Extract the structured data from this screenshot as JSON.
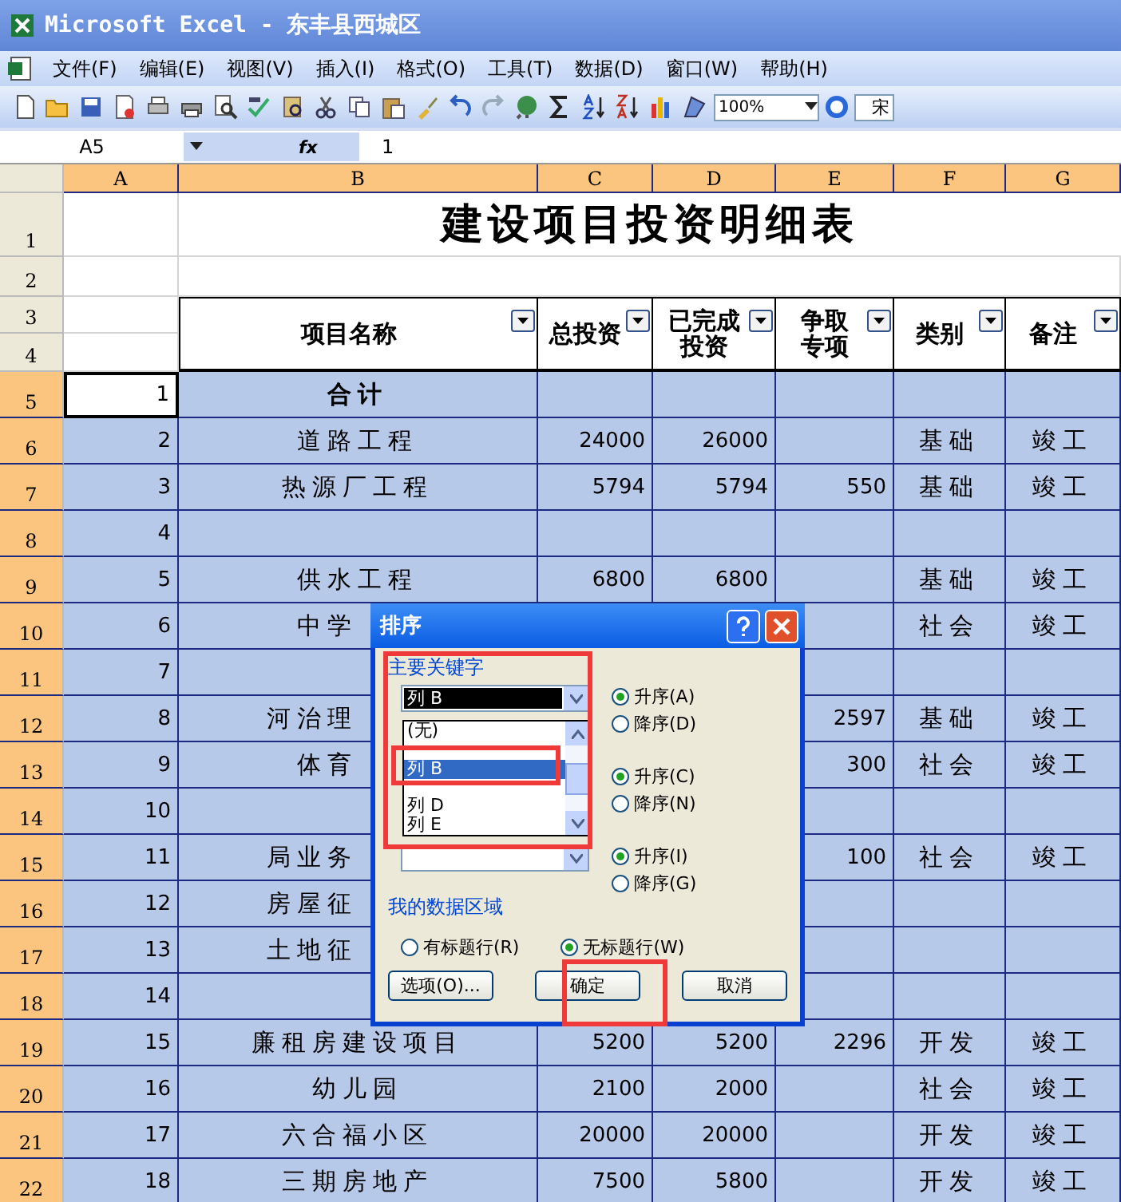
{
  "window": {
    "title": "Microsoft Excel - 东丰县西城区"
  },
  "menu": [
    {
      "label": "文件(F)"
    },
    {
      "label": "编辑(E)"
    },
    {
      "label": "视图(V)"
    },
    {
      "label": "插入(I)"
    },
    {
      "label": "格式(O)"
    },
    {
      "label": "工具(T)"
    },
    {
      "label": "数据(D)"
    },
    {
      "label": "窗口(W)"
    },
    {
      "label": "帮助(H)"
    }
  ],
  "toolbar": {
    "zoom": "100%",
    "font": "宋"
  },
  "formula_bar": {
    "cell": "A5",
    "fx": "fx",
    "value": "1"
  },
  "sheet": {
    "columns": [
      {
        "label": "A"
      },
      {
        "label": "B"
      },
      {
        "label": "C"
      },
      {
        "label": "D"
      },
      {
        "label": "E"
      },
      {
        "label": "F"
      },
      {
        "label": "G"
      }
    ],
    "top_rows": [
      {
        "header": "1"
      },
      {
        "header": "2"
      },
      {
        "header": "3"
      },
      {
        "header": "4"
      }
    ],
    "title": "建设项目投资明细表",
    "headers": [
      {
        "lines": [
          "项目名称"
        ]
      },
      {
        "lines": [
          "总投资"
        ]
      },
      {
        "lines": [
          "已完成",
          "投资"
        ]
      },
      {
        "lines": [
          "争取",
          "专项"
        ]
      },
      {
        "lines": [
          "类别"
        ]
      },
      {
        "lines": [
          "备注"
        ]
      }
    ],
    "rows": [
      {
        "header": "5",
        "selected": true,
        "active": true,
        "total": true,
        "cells": {
          "a": "1",
          "b": "合计"
        }
      },
      {
        "header": "6",
        "selected": true,
        "active": false,
        "total": false,
        "cells": {
          "a": "2",
          "b": "道路工程",
          "c": "24000",
          "d": "26000",
          "f": "基础",
          "g": "竣工"
        }
      },
      {
        "header": "7",
        "selected": true,
        "active": false,
        "total": false,
        "cells": {
          "a": "3",
          "b": "热源厂工程",
          "c": "5794",
          "d": "5794",
          "e": "550",
          "f": "基础",
          "g": "竣工"
        }
      },
      {
        "header": "8",
        "selected": true,
        "active": false,
        "total": false,
        "cells": {
          "a": "4"
        }
      },
      {
        "header": "9",
        "selected": true,
        "active": false,
        "total": false,
        "cells": {
          "a": "5",
          "b": "供水工程",
          "c": "6800",
          "d": "6800",
          "f": "基础",
          "g": "竣工"
        }
      },
      {
        "header": "10",
        "selected": true,
        "active": false,
        "total": false,
        "cells": {
          "a": "6",
          "b": "中学",
          "f": "社会",
          "g": "竣工"
        }
      },
      {
        "header": "11",
        "selected": true,
        "active": false,
        "total": false,
        "cells": {
          "a": "7"
        }
      },
      {
        "header": "12",
        "selected": true,
        "active": false,
        "total": false,
        "cells": {
          "a": "8",
          "b": "河治理",
          "e": "2597",
          "f": "基础",
          "g": "竣工"
        }
      },
      {
        "header": "13",
        "selected": true,
        "active": false,
        "total": false,
        "cells": {
          "a": "9",
          "b": "体育",
          "e": "300",
          "f": "社会",
          "g": "竣工"
        }
      },
      {
        "header": "14",
        "selected": true,
        "active": false,
        "total": false,
        "cells": {
          "a": "10"
        }
      },
      {
        "header": "15",
        "selected": true,
        "active": false,
        "total": false,
        "cells": {
          "a": "11",
          "b": "局业务",
          "e": "100",
          "f": "社会",
          "g": "竣工"
        }
      },
      {
        "header": "16",
        "selected": true,
        "active": false,
        "total": false,
        "cells": {
          "a": "12",
          "b": "房屋征"
        }
      },
      {
        "header": "17",
        "selected": true,
        "active": false,
        "total": false,
        "cells": {
          "a": "13",
          "b": "土地征"
        }
      },
      {
        "header": "18",
        "selected": true,
        "active": false,
        "total": false,
        "cells": {
          "a": "14"
        }
      },
      {
        "header": "19",
        "selected": true,
        "active": false,
        "total": false,
        "cells": {
          "a": "15",
          "b": "廉租房建设项目",
          "c": "5200",
          "d": "5200",
          "e": "2296",
          "f": "开发",
          "g": "竣工"
        }
      },
      {
        "header": "20",
        "selected": true,
        "active": false,
        "total": false,
        "cells": {
          "a": "16",
          "b": "幼儿园",
          "c": "2100",
          "d": "2000",
          "f": "社会",
          "g": "竣工"
        }
      },
      {
        "header": "21",
        "selected": true,
        "active": false,
        "total": false,
        "cells": {
          "a": "17",
          "b": "六合福小区",
          "c": "20000",
          "d": "20000",
          "f": "开发",
          "g": "竣工"
        }
      },
      {
        "header": "22",
        "selected": true,
        "active": false,
        "total": false,
        "cells": {
          "a": "18",
          "b": "三期房地产",
          "c": "7500",
          "d": "5800",
          "f": "开发",
          "g": "竣工"
        }
      }
    ]
  },
  "dialog": {
    "title": "排序",
    "keys": [
      {
        "label": "主要关键字",
        "value": "列 B",
        "order": [
          {
            "label": "升序(A)",
            "selected": true
          },
          {
            "label": "降序(D)",
            "selected": false
          }
        ]
      },
      {
        "order": [
          {
            "label": "升序(C)",
            "selected": true
          },
          {
            "label": "降序(N)",
            "selected": false
          }
        ]
      },
      {
        "order": [
          {
            "label": "升序(I)",
            "selected": true
          },
          {
            "label": "降序(G)",
            "selected": false
          }
        ]
      }
    ],
    "dropdown": [
      {
        "label": "(无)",
        "selected": false
      },
      {
        "selected": false
      },
      {
        "label": "列 B",
        "selected": true
      },
      {
        "selected": false
      },
      {
        "label": "列 D",
        "selected": false
      },
      {
        "label": "列 E",
        "selected": false
      }
    ],
    "range_label": "我的数据区域",
    "range_options": [
      {
        "label": "有标题行(R)",
        "selected": false
      },
      {
        "label": "无标题行(W)",
        "selected": true
      }
    ],
    "buttons": [
      {
        "label": "选项(O)..."
      },
      {
        "label": "确定"
      },
      {
        "label": "取消"
      }
    ]
  }
}
